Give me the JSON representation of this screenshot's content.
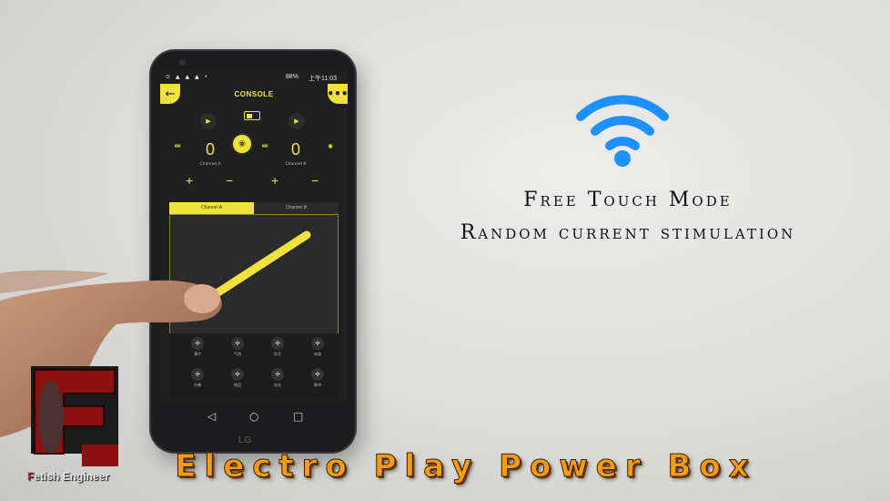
{
  "phone": {
    "status_time": "上午11:03",
    "status_battery": "88%",
    "status_left_icons": "⊙ ▲ ▲ ▲ •",
    "header": {
      "title": "CONSOLE",
      "back_icon": "←",
      "menu_icon": "•••"
    },
    "channels": [
      {
        "label": "Channel A",
        "value": "0",
        "plus": "+",
        "minus": "−"
      },
      {
        "label": "Channel B",
        "value": "0",
        "plus": "+",
        "minus": "−"
      }
    ],
    "tabs": [
      "Channel A",
      "Channel B"
    ],
    "active_tab": "Channel A",
    "patterns": [
      {
        "label": "潮汐"
      },
      {
        "label": "气泡"
      },
      {
        "label": "信号"
      },
      {
        "label": "电波"
      },
      {
        "label": "节奏"
      },
      {
        "label": "挑逗"
      },
      {
        "label": "连击"
      },
      {
        "label": "脉冲"
      }
    ],
    "brand": "LG",
    "accent_color": "#f0e23c"
  },
  "wifi_icon": "wifi-icon",
  "wifi_color": "#1e90ff",
  "captions": [
    "Free Touch Mode",
    "Random current stimulation"
  ],
  "logo": {
    "letter": "F",
    "text_first": "F",
    "text_rest": "etish Engineer"
  },
  "title": "Electro Play Power Box",
  "title_color": "#f39c12"
}
